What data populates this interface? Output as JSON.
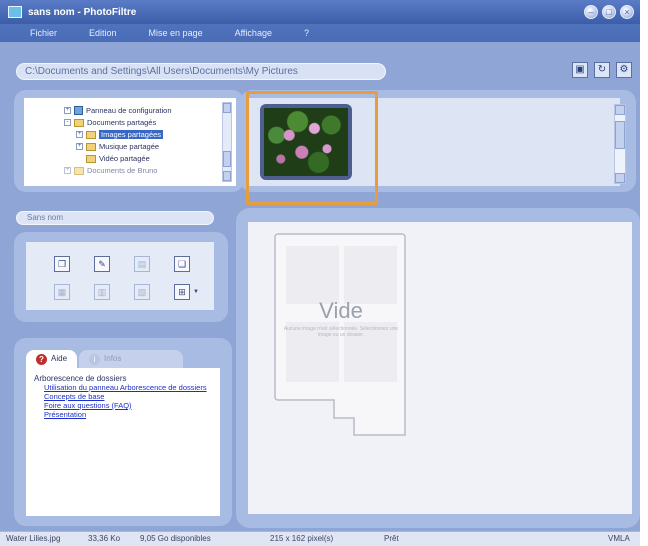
{
  "window": {
    "title": "sans nom - PhotoFiltre",
    "controls": [
      "minimize",
      "maximize",
      "close"
    ]
  },
  "menu": [
    "Fichier",
    "Edition",
    "Mise en page",
    "Affichage",
    "?"
  ],
  "path": "C:\\Documents and Settings\\All Users\\Documents\\My Pictures",
  "toolbar_icons": [
    "photo-icon",
    "refresh-icon",
    "options-icon"
  ],
  "tree": [
    {
      "label": "Panneau de configuration",
      "expander": "+",
      "icon": "control-panel-icon"
    },
    {
      "label": "Documents partagés",
      "expander": "-",
      "icon": "folder-icon"
    },
    {
      "label": "Images partagées",
      "expander": "+",
      "icon": "folder-icon",
      "selected": true
    },
    {
      "label": "Musique partagée",
      "expander": "+",
      "icon": "folder-icon"
    },
    {
      "label": "Vidéo partagée",
      "expander": "",
      "icon": "folder-icon"
    },
    {
      "label": "Documents de Bruno",
      "expander": "+",
      "icon": "folder-icon"
    }
  ],
  "thumbnails": [
    {
      "name": "Water Lilies.jpg",
      "selected": true
    }
  ],
  "name_field": "Sans nom",
  "tools": [
    {
      "icon": "copy-icon",
      "enabled": true
    },
    {
      "icon": "edit-icon",
      "enabled": true
    },
    {
      "icon": "move-icon",
      "enabled": false
    },
    {
      "icon": "paste-icon",
      "enabled": true
    },
    {
      "icon": "delete-icon",
      "enabled": false
    },
    {
      "icon": "rename-icon",
      "enabled": false
    },
    {
      "icon": "properties-icon",
      "enabled": false
    },
    {
      "icon": "view-mode-icon",
      "enabled": true,
      "has_dropdown": true
    }
  ],
  "help": {
    "tabs": [
      "Aide",
      "Infos"
    ],
    "heading": "Arborescence de dossiers",
    "links": [
      "Utilisation du panneau Arborescence de dossiers",
      "Concepts de base",
      "Foire aux questions (FAQ)",
      "Présentation"
    ]
  },
  "preview": {
    "title": "Vide",
    "description": "Aucune image n'est sélectionnée. Sélectionnez une image ou un dossier."
  },
  "status": {
    "file": "Water Lilies.jpg",
    "size": "33,36 Ko",
    "disk": "9,05 Go disponibles",
    "dimensions": "215 x 162 pixel(s)",
    "state": "Prêt",
    "mode": "VMLA"
  }
}
